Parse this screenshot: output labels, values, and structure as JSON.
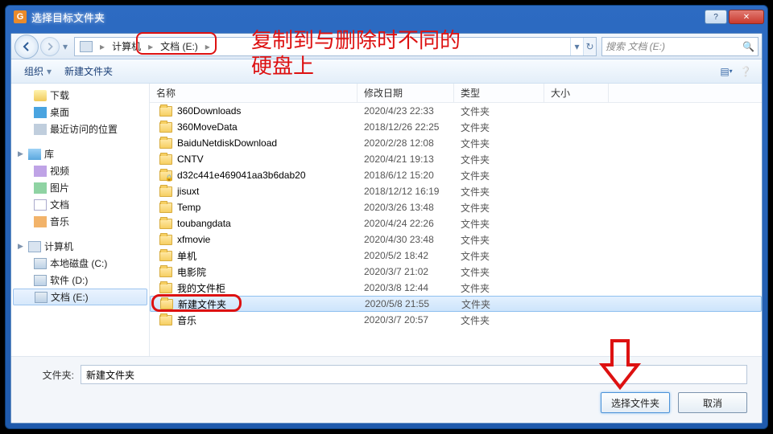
{
  "window": {
    "title": "选择目标文件夹"
  },
  "nav": {
    "crumbs": [
      "计算机",
      "文档 (E:)"
    ],
    "search_placeholder": "搜索 文档 (E:)"
  },
  "toolbar": {
    "organize": "组织",
    "newfolder": "新建文件夹"
  },
  "tree": {
    "fav_downloads": "下载",
    "fav_desktop": "桌面",
    "fav_recent": "最近访问的位置",
    "libs": "库",
    "lib_video": "视频",
    "lib_pictures": "图片",
    "lib_docs": "文档",
    "lib_music": "音乐",
    "computer": "计算机",
    "drive_c": "本地磁盘 (C:)",
    "drive_d": "软件 (D:)",
    "drive_e": "文档 (E:)"
  },
  "columns": {
    "name": "名称",
    "date": "修改日期",
    "type": "类型",
    "size": "大小"
  },
  "rows": [
    {
      "name": "360Downloads",
      "date": "2020/4/23 22:33",
      "type": "文件夹"
    },
    {
      "name": "360MoveData",
      "date": "2018/12/26 22:25",
      "type": "文件夹"
    },
    {
      "name": "BaiduNetdiskDownload",
      "date": "2020/2/28 12:08",
      "type": "文件夹"
    },
    {
      "name": "CNTV",
      "date": "2020/4/21 19:13",
      "type": "文件夹"
    },
    {
      "name": "d32c441e469041aa3b6dab20",
      "date": "2018/6/12 15:20",
      "type": "文件夹",
      "locked": true
    },
    {
      "name": "jisuxt",
      "date": "2018/12/12 16:19",
      "type": "文件夹"
    },
    {
      "name": "Temp",
      "date": "2020/3/26 13:48",
      "type": "文件夹"
    },
    {
      "name": "toubangdata",
      "date": "2020/4/24 22:26",
      "type": "文件夹"
    },
    {
      "name": "xfmovie",
      "date": "2020/4/30 23:48",
      "type": "文件夹"
    },
    {
      "name": "单机",
      "date": "2020/5/2 18:42",
      "type": "文件夹"
    },
    {
      "name": "电影院",
      "date": "2020/3/7 21:02",
      "type": "文件夹"
    },
    {
      "name": "我的文件柜",
      "date": "2020/3/8 12:44",
      "type": "文件夹"
    },
    {
      "name": "新建文件夹",
      "date": "2020/5/8 21:55",
      "type": "文件夹",
      "selected": true
    },
    {
      "name": "音乐",
      "date": "2020/3/7 20:57",
      "type": "文件夹"
    }
  ],
  "footer": {
    "field_label": "文件夹:",
    "field_value": "新建文件夹",
    "select_btn": "选择文件夹",
    "cancel_btn": "取消"
  },
  "annotations": {
    "line1": "复制到与删除时不同的",
    "line2": "硬盘上"
  }
}
